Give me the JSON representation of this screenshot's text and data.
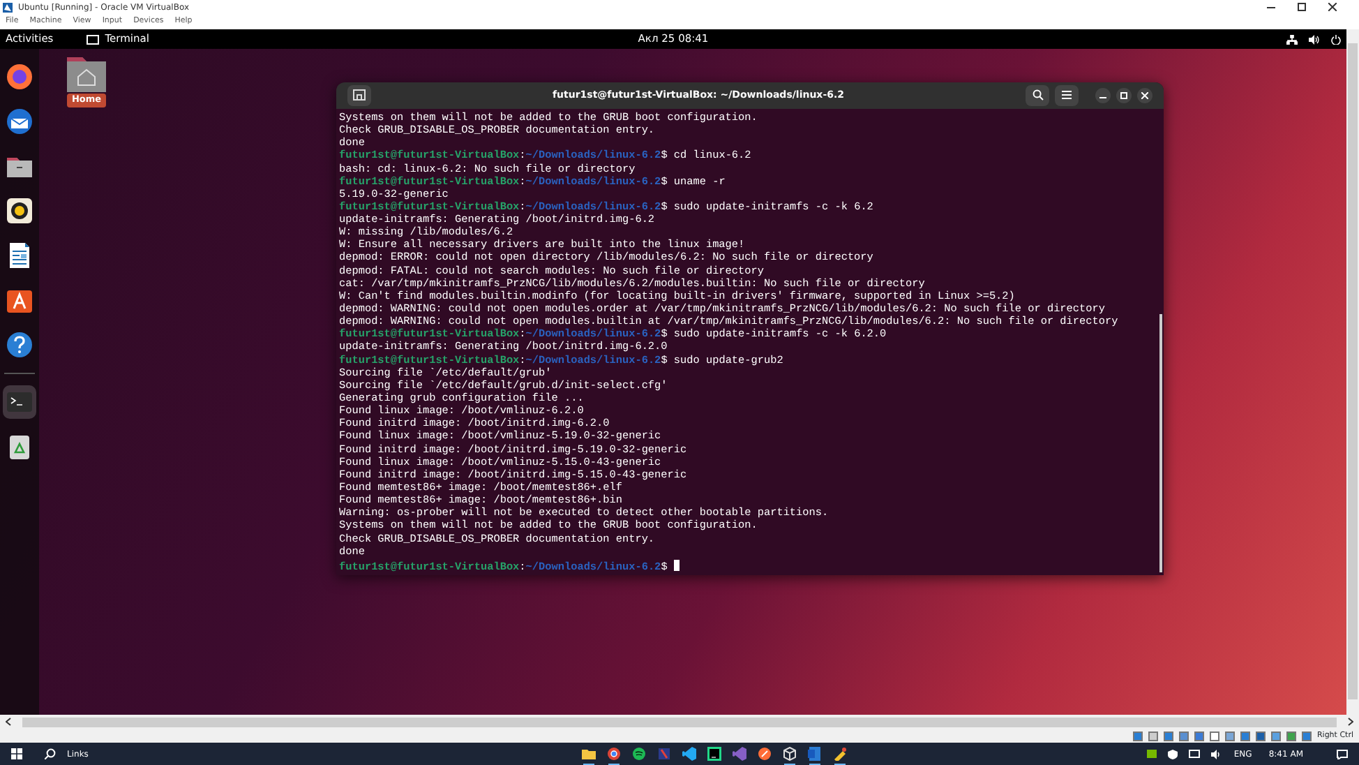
{
  "vbox_window": {
    "title": "Ubuntu [Running] - Oracle VM VirtualBox",
    "menu": [
      "File",
      "Machine",
      "View",
      "Input",
      "Devices",
      "Help"
    ]
  },
  "top_bar": {
    "activities": "Activities",
    "app": "Terminal",
    "clock": "Акл 25  08:41"
  },
  "dock": [
    {
      "kind": "browser",
      "selected": false
    },
    {
      "kind": "mail",
      "selected": false
    },
    {
      "kind": "files",
      "selected": false
    },
    {
      "kind": "music",
      "selected": false
    },
    {
      "kind": "writer",
      "selected": false
    },
    {
      "kind": "store",
      "selected": false
    },
    {
      "kind": "help",
      "selected": false
    },
    {
      "kind": "terminal",
      "selected": true
    },
    {
      "kind": "trash",
      "selected": false
    }
  ],
  "desktop_icons": [
    {
      "label": "Home"
    }
  ],
  "terminal": {
    "title": "futur1st@futur1st-VirtualBox: ~/Downloads/linux-6.2",
    "lines": [
      {
        "kind": "out",
        "text": "Systems on them will not be added to the GRUB boot configuration."
      },
      {
        "kind": "out",
        "text": "Check GRUB_DISABLE_OS_PROBER documentation entry."
      },
      {
        "kind": "out",
        "text": "done"
      },
      {
        "kind": "prompt",
        "user": "futur1st@futur1st-VirtualBox",
        "sep": ":",
        "path": "~/Downloads/linux-6.2",
        "command": "$ cd linux-6.2",
        "cursor": false
      },
      {
        "kind": "out",
        "text": "bash: cd: linux-6.2: No such file or directory"
      },
      {
        "kind": "prompt",
        "user": "futur1st@futur1st-VirtualBox",
        "sep": ":",
        "path": "~/Downloads/linux-6.2",
        "command": "$ uname -r",
        "cursor": false
      },
      {
        "kind": "out",
        "text": "5.19.0-32-generic"
      },
      {
        "kind": "prompt",
        "user": "futur1st@futur1st-VirtualBox",
        "sep": ":",
        "path": "~/Downloads/linux-6.2",
        "command": "$ sudo update-initramfs -c -k 6.2",
        "cursor": false
      },
      {
        "kind": "out",
        "text": "update-initramfs: Generating /boot/initrd.img-6.2"
      },
      {
        "kind": "out",
        "text": "W: missing /lib/modules/6.2"
      },
      {
        "kind": "out",
        "text": "W: Ensure all necessary drivers are built into the linux image!"
      },
      {
        "kind": "out",
        "text": "depmod: ERROR: could not open directory /lib/modules/6.2: No such file or directory"
      },
      {
        "kind": "out",
        "text": "depmod: FATAL: could not search modules: No such file or directory"
      },
      {
        "kind": "out",
        "text": "cat: /var/tmp/mkinitramfs_PrzNCG/lib/modules/6.2/modules.builtin: No such file or directory"
      },
      {
        "kind": "out",
        "text": "W: Can't find modules.builtin.modinfo (for locating built-in drivers' firmware, supported in Linux >=5.2)"
      },
      {
        "kind": "out",
        "text": "depmod: WARNING: could not open modules.order at /var/tmp/mkinitramfs_PrzNCG/lib/modules/6.2: No such file or directory"
      },
      {
        "kind": "out",
        "text": "depmod: WARNING: could not open modules.builtin at /var/tmp/mkinitramfs_PrzNCG/lib/modules/6.2: No such file or directory"
      },
      {
        "kind": "prompt",
        "user": "futur1st@futur1st-VirtualBox",
        "sep": ":",
        "path": "~/Downloads/linux-6.2",
        "command": "$ sudo update-initramfs -c -k 6.2.0",
        "cursor": false
      },
      {
        "kind": "out",
        "text": "update-initramfs: Generating /boot/initrd.img-6.2.0"
      },
      {
        "kind": "prompt",
        "user": "futur1st@futur1st-VirtualBox",
        "sep": ":",
        "path": "~/Downloads/linux-6.2",
        "command": "$ sudo update-grub2",
        "cursor": false
      },
      {
        "kind": "out",
        "text": "Sourcing file `/etc/default/grub'"
      },
      {
        "kind": "out",
        "text": "Sourcing file `/etc/default/grub.d/init-select.cfg'"
      },
      {
        "kind": "out",
        "text": "Generating grub configuration file ..."
      },
      {
        "kind": "out",
        "text": "Found linux image: /boot/vmlinuz-6.2.0"
      },
      {
        "kind": "out",
        "text": "Found initrd image: /boot/initrd.img-6.2.0"
      },
      {
        "kind": "out",
        "text": "Found linux image: /boot/vmlinuz-5.19.0-32-generic"
      },
      {
        "kind": "out",
        "text": "Found initrd image: /boot/initrd.img-5.19.0-32-generic"
      },
      {
        "kind": "out",
        "text": "Found linux image: /boot/vmlinuz-5.15.0-43-generic"
      },
      {
        "kind": "out",
        "text": "Found initrd image: /boot/initrd.img-5.15.0-43-generic"
      },
      {
        "kind": "out",
        "text": "Found memtest86+ image: /boot/memtest86+.elf"
      },
      {
        "kind": "out",
        "text": "Found memtest86+ image: /boot/memtest86+.bin"
      },
      {
        "kind": "out",
        "text": "Warning: os-prober will not be executed to detect other bootable partitions."
      },
      {
        "kind": "out",
        "text": "Systems on them will not be added to the GRUB boot configuration."
      },
      {
        "kind": "out",
        "text": "Check GRUB_DISABLE_OS_PROBER documentation entry."
      },
      {
        "kind": "out",
        "text": "done"
      },
      {
        "kind": "prompt",
        "user": "futur1st@futur1st-VirtualBox",
        "sep": ":",
        "path": "~/Downloads/linux-6.2",
        "command": "$ ",
        "cursor": true
      }
    ]
  },
  "vbox_status": {
    "host_key": "Right Ctrl"
  },
  "taskbar": {
    "search": "Links",
    "apps": [
      {
        "kind": "folder",
        "running": true
      },
      {
        "kind": "chrome",
        "running": true
      },
      {
        "kind": "spotify",
        "running": false
      },
      {
        "kind": "tool",
        "running": false
      },
      {
        "kind": "code",
        "running": false
      },
      {
        "kind": "pycharm",
        "running": false
      },
      {
        "kind": "studio",
        "running": false
      },
      {
        "kind": "postman",
        "running": false
      },
      {
        "kind": "cube",
        "running": true
      },
      {
        "kind": "word",
        "running": true
      },
      {
        "kind": "paint",
        "running": true
      }
    ],
    "language": "ENG",
    "time": "8:41 AM"
  }
}
